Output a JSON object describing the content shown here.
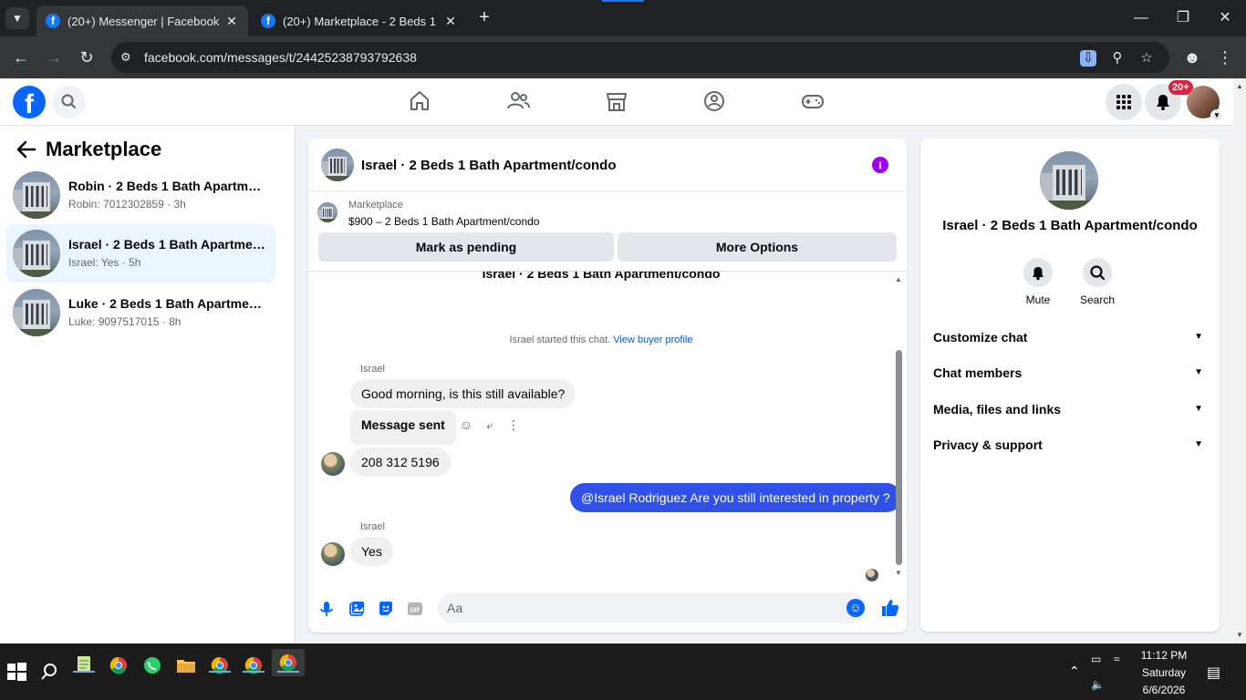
{
  "browser": {
    "tabs": [
      {
        "title": "(20+) Messenger | Facebook",
        "active": true
      },
      {
        "title": "(20+) Marketplace - 2 Beds 1 Ba",
        "active": false
      }
    ],
    "url": "facebook.com/messages/t/24425238793792638",
    "icons": [
      "back-arrow-icon",
      "forward-arrow-icon",
      "reload-icon",
      "site-info-icon",
      "install-app-icon",
      "zoom-icon",
      "bookmark-star-icon",
      "profile-icon",
      "kebab-menu-icon"
    ]
  },
  "fb_header": {
    "logo": "f",
    "notifications_badge": "20+",
    "nav_icons": [
      "home-icon",
      "friends-icon",
      "marketplace-icon",
      "groups-icon",
      "gaming-icon"
    ]
  },
  "sidebar": {
    "title": "Marketplace",
    "conversations": [
      {
        "name": "Robin · 2 Beds 1 Bath Apartmen...",
        "preview": "Robin: 7012302859 · 3h",
        "active": false
      },
      {
        "name": "Israel · 2 Beds 1 Bath Apartment...",
        "preview": "Israel: Yes · 5h",
        "active": true
      },
      {
        "name": "Luke · 2 Beds 1 Bath Apartment/...",
        "preview": "Luke: 9097517015 · 8h",
        "active": false
      }
    ]
  },
  "chat": {
    "title": "Israel · 2 Beds 1 Bath Apartment/condo",
    "marketplace_label": "Marketplace",
    "listing": "$900 – 2 Beds 1 Bath Apartment/condo",
    "buttons": {
      "pending": "Mark as pending",
      "more": "More Options"
    },
    "cut_title": "Israel · 2 Beds 1 Bath Apartment/condo",
    "system_text": "Israel started this chat.",
    "system_link": "View buyer profile",
    "messages": [
      {
        "sender": "Israel",
        "text": "Good morning, is this still available?"
      },
      {
        "text": "Message sent"
      },
      {
        "text": "208 312 5196"
      },
      {
        "text": "@Israel Rodriguez Are you still interested in property ?",
        "mine": true
      },
      {
        "sender": "Israel",
        "text": "Yes"
      }
    ],
    "composer_placeholder": "Aa"
  },
  "info": {
    "title": "Israel · 2 Beds 1 Bath Apartment/condo",
    "actions": [
      {
        "label": "Mute"
      },
      {
        "label": "Search"
      }
    ],
    "sections": [
      "Customize chat",
      "Chat members",
      "Media, files and links",
      "Privacy & support"
    ]
  },
  "taskbar": {
    "time": "11:12 PM",
    "day": "Saturday",
    "date": "6/6/2026"
  },
  "colors": {
    "fb_blue": "#0866ff",
    "my_bubble": "#3051e8",
    "info_purple": "#a200f5",
    "badge_red": "#e41e3f"
  }
}
